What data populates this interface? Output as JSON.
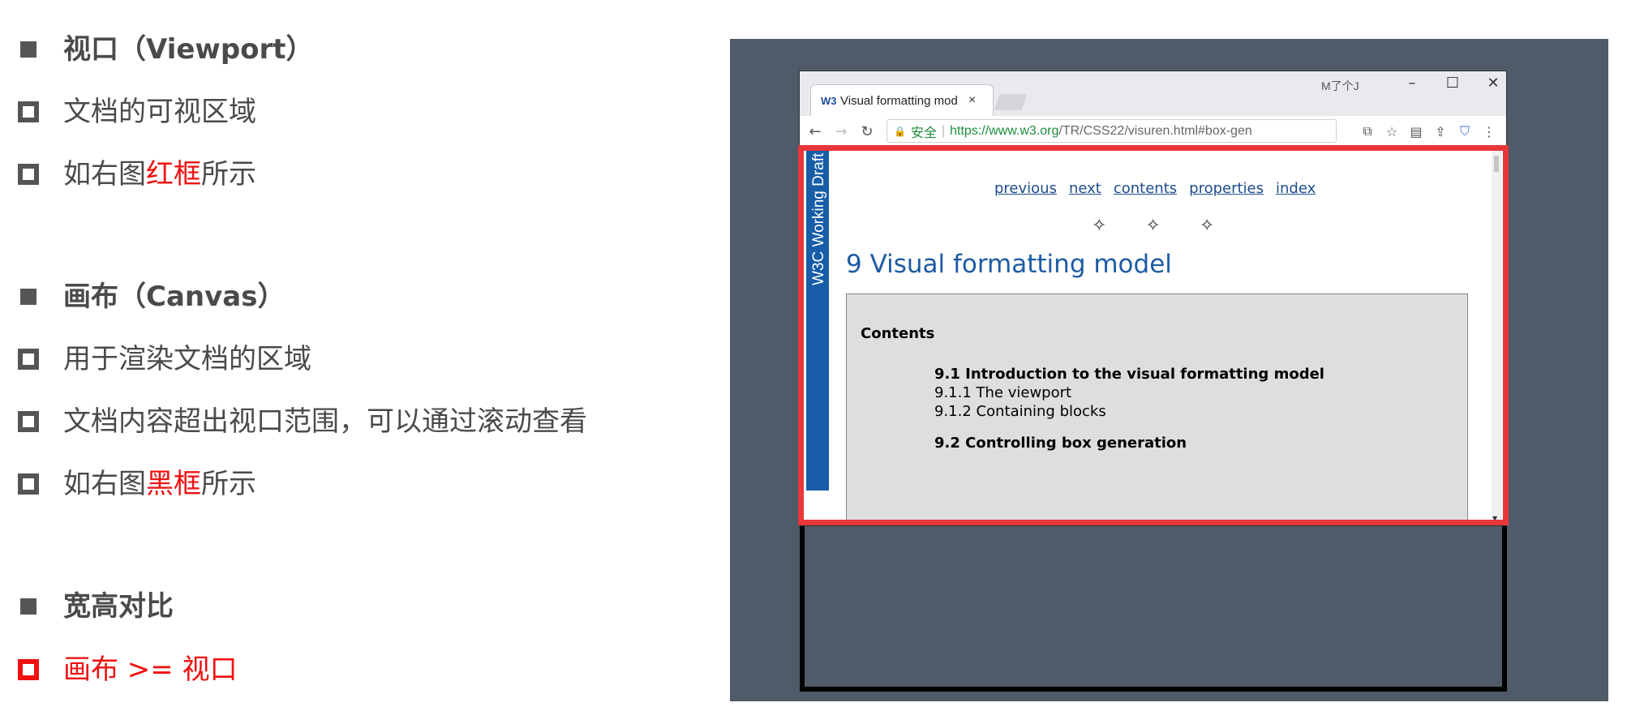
{
  "bullets": [
    {
      "type": "solid",
      "bold": true,
      "pre": "视口（Viewport）",
      "hl": "",
      "post": ""
    },
    {
      "type": "hollow",
      "bold": false,
      "pre": "文档的可视区域",
      "hl": "",
      "post": ""
    },
    {
      "type": "hollow",
      "bold": false,
      "pre": "如右图",
      "hl": "红框",
      "post": "所示"
    },
    {
      "type": "solid",
      "bold": true,
      "pre": "画布（Canvas）",
      "hl": "",
      "post": ""
    },
    {
      "type": "hollow",
      "bold": false,
      "pre": "用于渲染文档的区域",
      "hl": "",
      "post": ""
    },
    {
      "type": "hollow",
      "bold": false,
      "pre": "文档内容超出视口范围，可以通过滚动查看",
      "hl": "",
      "post": ""
    },
    {
      "type": "hollow",
      "bold": false,
      "pre": "如右图",
      "hl": "黑框",
      "post": "所示"
    },
    {
      "type": "solid",
      "bold": true,
      "pre": "宽高对比",
      "hl": "",
      "post": ""
    },
    {
      "type": "hollow-red",
      "bold": false,
      "pre": "",
      "hl": "画布 >= 视口",
      "post": ""
    }
  ],
  "browser": {
    "tab_favicon": "W3",
    "tab_title": "Visual formatting mod",
    "tab_close": "×",
    "user_badge": "M了个J",
    "win_minimize": "–",
    "win_maximize": "☐",
    "win_close": "✕",
    "secure_label": "安全",
    "url_host": "https://www.w3.org",
    "url_path": "/TR/CSS22/visuren.html#box-gen"
  },
  "page": {
    "vertical_banner": "W3C Working Draft",
    "nav": [
      "previous",
      "next",
      "contents",
      "properties",
      "index"
    ],
    "stars": "✧✧✧",
    "heading": "9 Visual formatting model",
    "toc_heading": "Contents",
    "toc_items": [
      {
        "text": "9.1 Introduction to the visual formatting model",
        "bold": true
      },
      {
        "text": "9.1.1 The viewport",
        "bold": false
      },
      {
        "text": "9.1.2 Containing blocks",
        "bold": false
      },
      {
        "text": "9.2 Controlling box generation",
        "bold": true
      }
    ]
  },
  "colors": {
    "viewport_frame": "#e8363b",
    "canvas_frame": "#000000",
    "stage_bg": "#505b69",
    "highlight_text": "#f01010"
  }
}
